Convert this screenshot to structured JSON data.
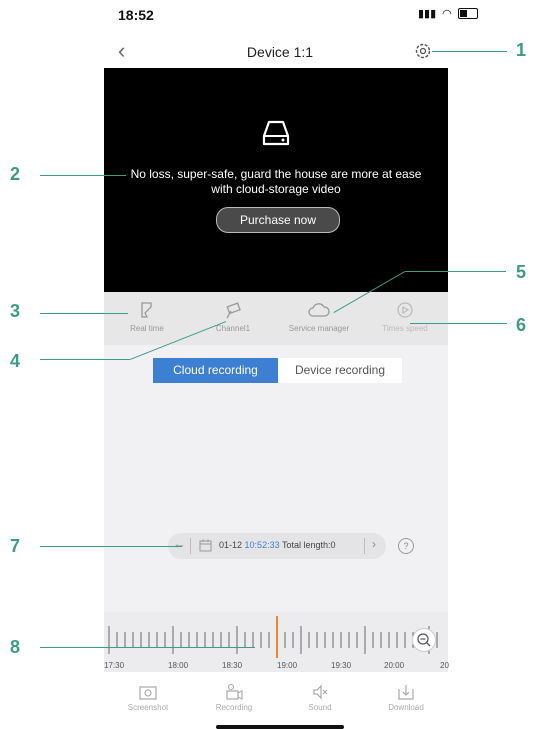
{
  "status": {
    "time": "18:52"
  },
  "nav": {
    "title": "Device 1:1"
  },
  "video": {
    "message_line1": "No loss, super-safe, guard the house are more at ease",
    "message_line2": "with cloud-storage video",
    "purchase_label": "Purchase now"
  },
  "toolbar": {
    "items": [
      {
        "label": "Real time",
        "icon": "rewind-arrow-icon"
      },
      {
        "label": "Channel1",
        "icon": "camera-icon"
      },
      {
        "label": "Service manager",
        "icon": "cloud-icon"
      },
      {
        "label": "Times speed",
        "icon": "speed-play-icon"
      }
    ]
  },
  "tabs": {
    "cloud": "Cloud recording",
    "device": "Device recording"
  },
  "date_bar": {
    "date": "01-12",
    "time": "10:52:33",
    "total_length": "Total length:0"
  },
  "timeline": {
    "labels": [
      "17:30",
      "18:00",
      "18:30",
      "19:00",
      "19:30",
      "20:00",
      "20"
    ]
  },
  "actions": [
    {
      "label": "Screenshot",
      "icon": "camera-icon"
    },
    {
      "label": "Recording",
      "icon": "video-recorder-icon"
    },
    {
      "label": "Sound",
      "icon": "speaker-muted-icon"
    },
    {
      "label": "Download",
      "icon": "download-icon"
    }
  ],
  "annotations": [
    "1",
    "2",
    "3",
    "4",
    "5",
    "6",
    "7",
    "8"
  ],
  "colors": {
    "accent": "#3d7fd1",
    "annotation": "#3d9b86",
    "playhead": "#f08a24"
  }
}
